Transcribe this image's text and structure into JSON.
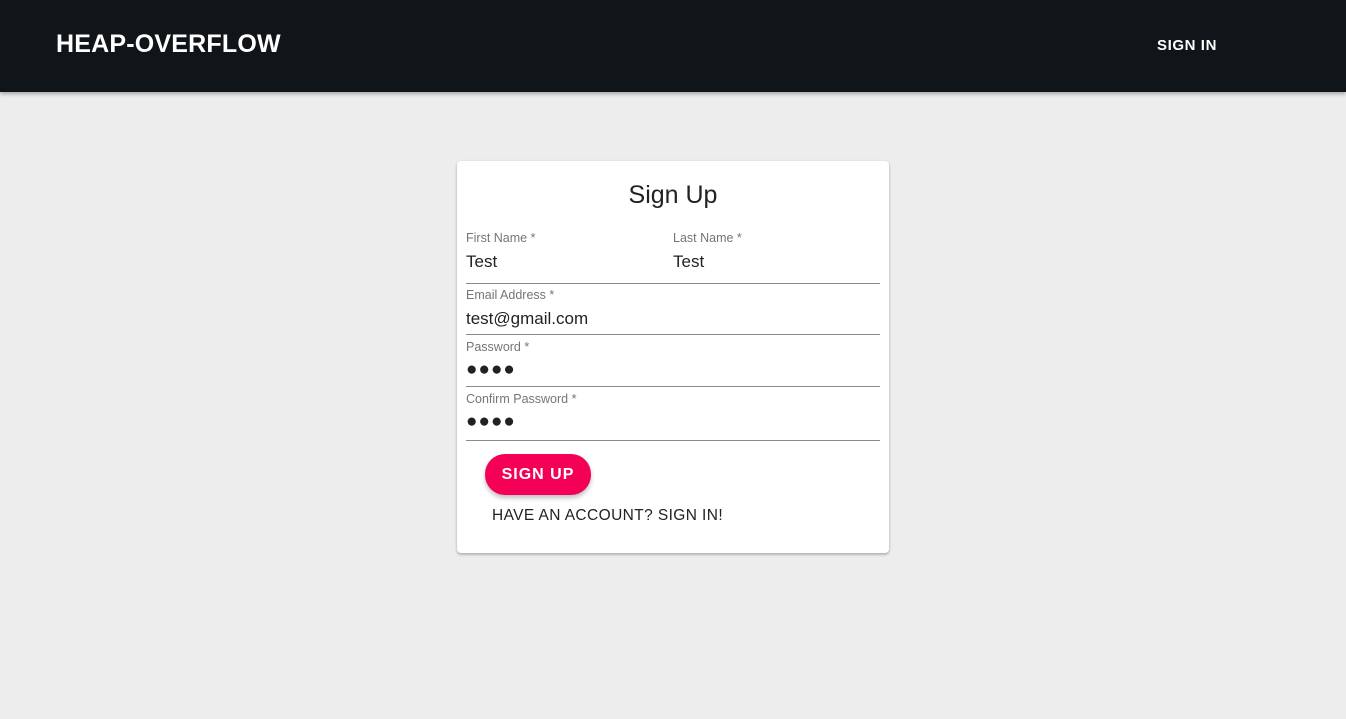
{
  "header": {
    "brand": "HEAP-OVERFLOW",
    "sign_in_label": "SIGN IN"
  },
  "form": {
    "title": "Sign Up",
    "first_name": {
      "label": "First Name *",
      "value": "Test"
    },
    "last_name": {
      "label": "Last Name *",
      "value": "Test"
    },
    "email": {
      "label": "Email Address *",
      "value": "test@gmail.com"
    },
    "password": {
      "label": "Password *",
      "value": "●●●●"
    },
    "confirm_password": {
      "label": "Confirm Password *",
      "value": "●●●●"
    },
    "submit_label": "SIGN UP",
    "signin_link": "HAVE AN ACCOUNT? SIGN IN!"
  },
  "colors": {
    "header_bg": "#0f1518",
    "page_bg": "#ededed",
    "accent": "#f50057"
  }
}
